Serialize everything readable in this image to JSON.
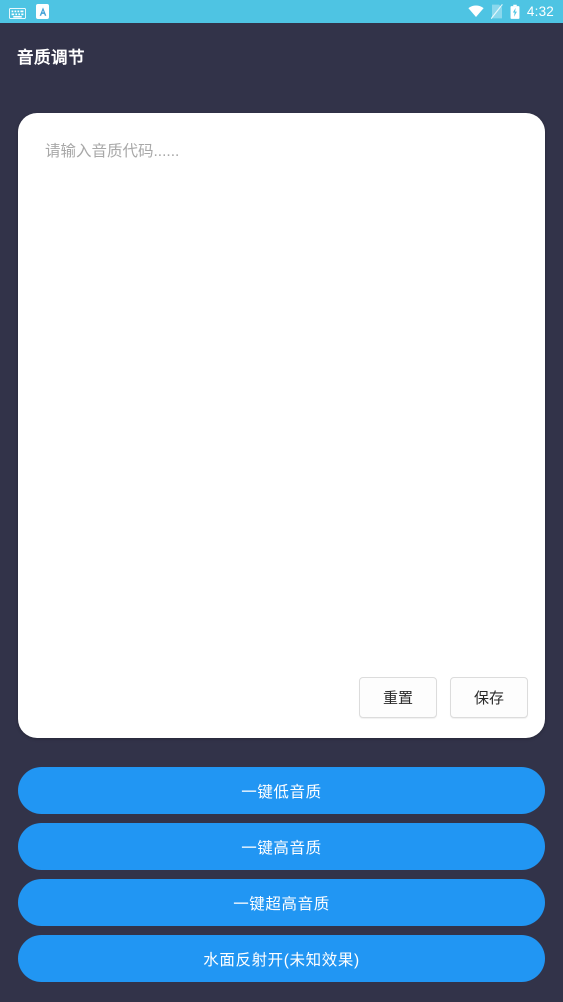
{
  "status_bar": {
    "background_color": "#4ec4e3",
    "left_icons": [
      {
        "name": "keyboard-icon",
        "label": "keyboard-icon"
      },
      {
        "name": "app-badge-icon",
        "label": "A"
      }
    ],
    "right_icons": [
      {
        "name": "wifi-icon",
        "label": "wifi-icon"
      },
      {
        "name": "sim-card-icon",
        "label": "sim-card-icon"
      },
      {
        "name": "battery-charging-icon",
        "label": "battery-charging-icon"
      }
    ],
    "time": "4:32"
  },
  "app_bar": {
    "title": "音质调节",
    "background_color": "#323349",
    "title_color": "#ffffff"
  },
  "card": {
    "background_color": "#ffffff",
    "input": {
      "placeholder": "请输入音质代码......",
      "value": ""
    },
    "buttons": [
      {
        "name": "reset-button",
        "label": "重置"
      },
      {
        "name": "save-button",
        "label": "保存"
      }
    ]
  },
  "actions": {
    "accent_color": "#2196f3",
    "buttons": [
      {
        "name": "preset-low-quality-button",
        "label": "一键低音质"
      },
      {
        "name": "preset-high-quality-button",
        "label": "一键高音质"
      },
      {
        "name": "preset-ultra-high-quality-button",
        "label": "一键超高音质"
      },
      {
        "name": "water-reflection-on-button",
        "label": "水面反射开(未知效果)"
      }
    ]
  },
  "page": {
    "background_color": "#323349"
  }
}
